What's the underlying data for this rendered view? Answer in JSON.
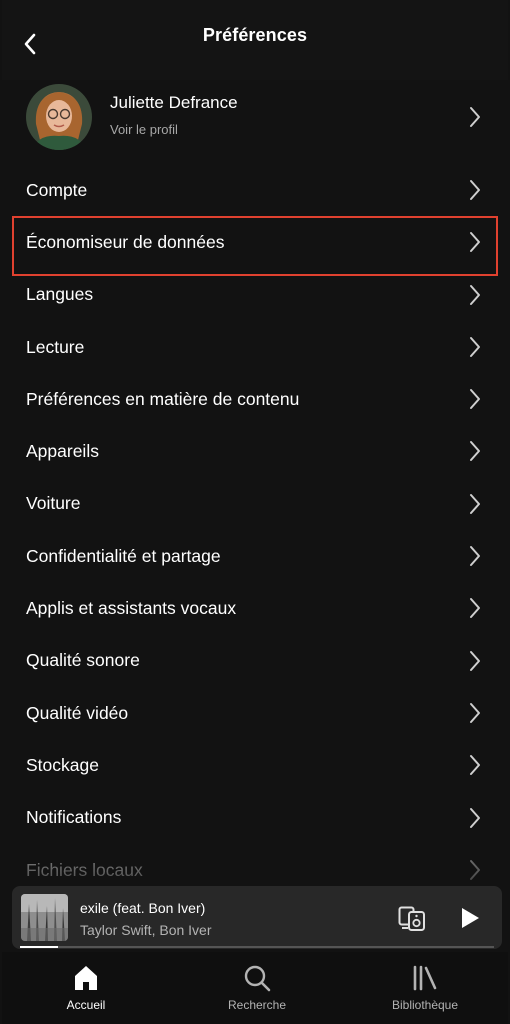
{
  "header": {
    "title": "Préférences"
  },
  "profile": {
    "name": "Juliette Defrance",
    "subtitle": "Voir le profil"
  },
  "menu": [
    {
      "label": "Compte"
    },
    {
      "label": "Économiseur de données",
      "highlighted": true
    },
    {
      "label": "Langues"
    },
    {
      "label": "Lecture"
    },
    {
      "label": "Préférences en matière de contenu"
    },
    {
      "label": "Appareils"
    },
    {
      "label": "Voiture"
    },
    {
      "label": "Confidentialité et partage"
    },
    {
      "label": "Applis et assistants vocaux"
    },
    {
      "label": "Qualité sonore"
    },
    {
      "label": "Qualité vidéo"
    },
    {
      "label": "Stockage"
    },
    {
      "label": "Notifications"
    },
    {
      "label": "Fichiers locaux"
    }
  ],
  "player": {
    "title": "exile (feat. Bon Iver)",
    "artist": "Taylor Swift, Bon Iver",
    "progress": 0.08
  },
  "nav": [
    {
      "label": "Accueil",
      "icon": "home-icon",
      "active": true
    },
    {
      "label": "Recherche",
      "icon": "search-icon",
      "active": false
    },
    {
      "label": "Bibliothèque",
      "icon": "library-icon",
      "active": false
    }
  ],
  "colors": {
    "background": "#121212",
    "highlight": "#e0412f",
    "secondary_text": "#a7a7a7"
  }
}
